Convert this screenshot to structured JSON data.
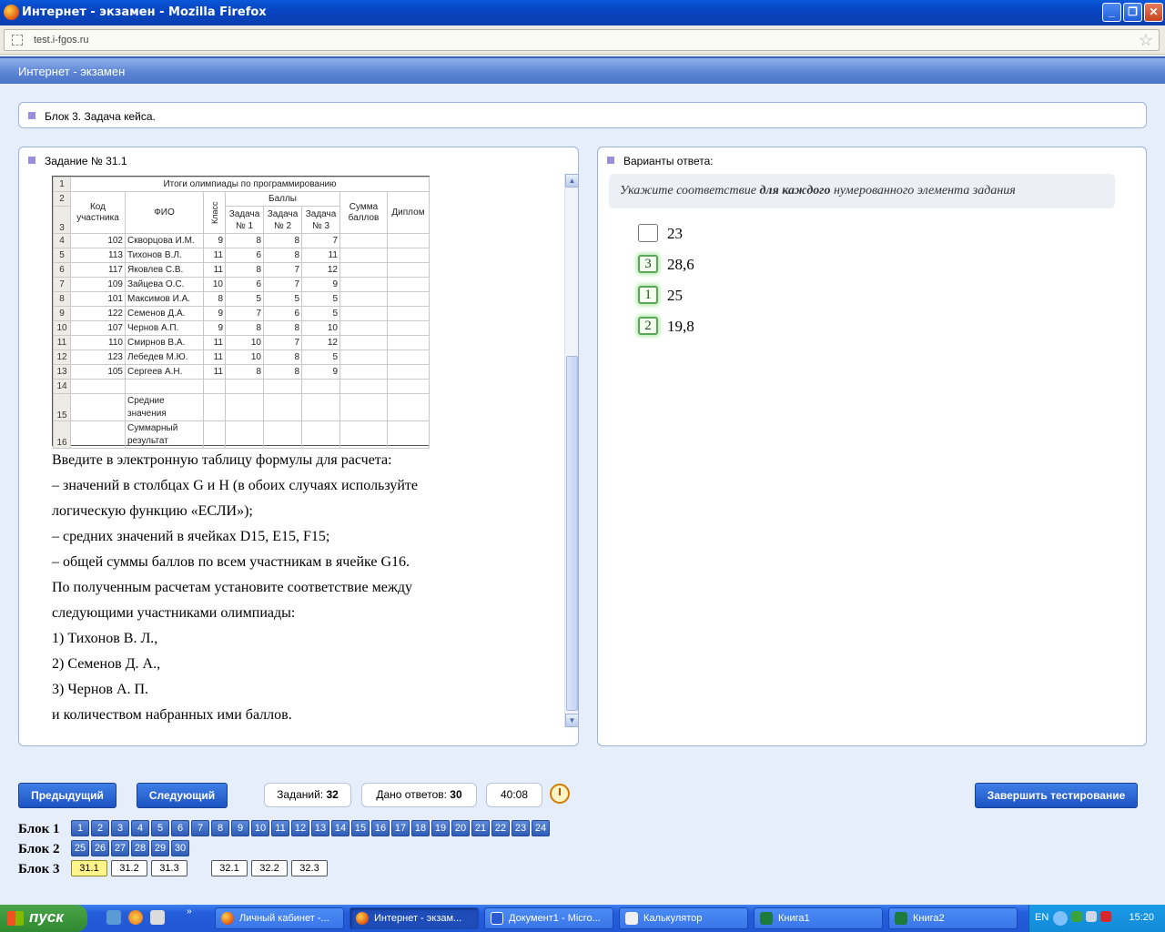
{
  "window": {
    "title": "Интернет - экзамен - Mozilla Firefox",
    "url": "test.i-fgos.ru"
  },
  "app": {
    "header": "Интернет - экзамен",
    "block_label": "Блок 3. Задача кейса."
  },
  "task": {
    "header": "Задание № 31.1",
    "sheet": {
      "title": "Итоги олимпиады по программированию",
      "headers": {
        "code": "Код участника",
        "fio": "ФИО",
        "class": "Класс",
        "points": "Баллы",
        "t1": "Задача № 1",
        "t2": "Задача № 2",
        "t3": "Задача № 3",
        "sum": "Сумма баллов",
        "diploma": "Диплом"
      },
      "rows": [
        {
          "r": "4",
          "code": "102",
          "fio": "Скворцова И.М.",
          "cls": "9",
          "t1": "8",
          "t2": "8",
          "t3": "7"
        },
        {
          "r": "5",
          "code": "113",
          "fio": "Тихонов В.Л.",
          "cls": "11",
          "t1": "6",
          "t2": "8",
          "t3": "11"
        },
        {
          "r": "6",
          "code": "117",
          "fio": "Яковлев С.В.",
          "cls": "11",
          "t1": "8",
          "t2": "7",
          "t3": "12"
        },
        {
          "r": "7",
          "code": "109",
          "fio": "Зайцева О.С.",
          "cls": "10",
          "t1": "6",
          "t2": "7",
          "t3": "9"
        },
        {
          "r": "8",
          "code": "101",
          "fio": "Максимов И.А.",
          "cls": "8",
          "t1": "5",
          "t2": "5",
          "t3": "5"
        },
        {
          "r": "9",
          "code": "122",
          "fio": "Семенов Д.А.",
          "cls": "9",
          "t1": "7",
          "t2": "6",
          "t3": "5"
        },
        {
          "r": "10",
          "code": "107",
          "fio": "Чернов А.П.",
          "cls": "9",
          "t1": "8",
          "t2": "8",
          "t3": "10"
        },
        {
          "r": "11",
          "code": "110",
          "fio": "Смирнов В.А.",
          "cls": "11",
          "t1": "10",
          "t2": "7",
          "t3": "12"
        },
        {
          "r": "12",
          "code": "123",
          "fio": "Лебедев М.Ю.",
          "cls": "11",
          "t1": "10",
          "t2": "8",
          "t3": "5"
        },
        {
          "r": "13",
          "code": "105",
          "fio": "Сергеев А.Н.",
          "cls": "11",
          "t1": "8",
          "t2": "8",
          "t3": "9"
        }
      ],
      "avg_label": "Средние значения",
      "total_label": "Суммарный результат"
    },
    "text_lines": [
      "Введите в электронную таблицу формулы для расчета:",
      "– значений в столбцах G  и H (в обоих случаях используйте",
      "логическую функцию «ЕСЛИ»);",
      "– средних значений в ячейках D15, E15, F15;",
      "– общей суммы баллов по всем участникам в ячейке G16.",
      "По полученным расчетам установите соответствие между",
      "следующими участниками олимпиады:",
      "1) Тихонов В. Л.,",
      "2) Семенов Д. А.,",
      "3) Чернов А. П.",
      "и количеством набранных ими баллов."
    ]
  },
  "answers": {
    "header": "Варианты ответа:",
    "instruction_pre": "Укажите соответствие ",
    "instruction_bold": "для каждого",
    "instruction_post": " нумерованного элемента задания",
    "options": [
      {
        "mark": "",
        "value": "23"
      },
      {
        "mark": "3",
        "value": "28,6"
      },
      {
        "mark": "1",
        "value": "25"
      },
      {
        "mark": "2",
        "value": "19,8"
      }
    ]
  },
  "nav": {
    "prev": "Предыдущий",
    "next": "Следующий",
    "tasks_label": "Заданий:",
    "tasks_count": "32",
    "answered_label": "Дано ответов:",
    "answered_count": "30",
    "timer": "40:08",
    "finish": "Завершить тестирование"
  },
  "blocks": [
    {
      "label": "Блок 1",
      "items": [
        "1",
        "2",
        "3",
        "4",
        "5",
        "6",
        "7",
        "8",
        "9",
        "10",
        "11",
        "12",
        "13",
        "14",
        "15",
        "16",
        "17",
        "18",
        "19",
        "20",
        "21",
        "22",
        "23",
        "24"
      ]
    },
    {
      "label": "Блок 2",
      "items": [
        "25",
        "26",
        "27",
        "28",
        "29",
        "30"
      ]
    },
    {
      "label": "Блок 3",
      "items": [
        "31.1",
        "31.2",
        "31.3",
        "32.1",
        "32.2",
        "32.3"
      ],
      "current": "31.1"
    }
  ],
  "taskbar": {
    "start": "пуск",
    "windows": [
      "Личный кабинет -...",
      "Интернет - экзам...",
      "Документ1 - Micro...",
      "Калькулятор",
      "Книга1",
      "Книга2"
    ],
    "lang": "EN",
    "time": "15:20"
  },
  "colors": {
    "accent": "#2f5db5",
    "selected_answer": "#5aa65a",
    "current_question": "#fff58a"
  }
}
